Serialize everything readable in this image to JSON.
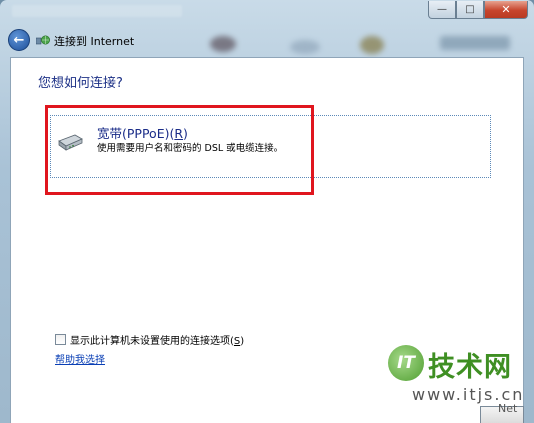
{
  "window": {
    "close_glyph": "✕",
    "minimize_glyph": "—",
    "maximize_glyph": "□"
  },
  "nav": {
    "back_glyph": "←",
    "title": "连接到 Internet"
  },
  "content": {
    "question": "您想如何连接?",
    "option": {
      "icon": "modem-icon",
      "title_prefix": "宽带(PPPoE)(",
      "title_accel": "R",
      "title_suffix": ")",
      "description": "使用需要用户名和密码的 DSL 或电缆连接。"
    },
    "checkbox": {
      "checked": false,
      "label_prefix": "显示此计算机未设置使用的连接选项(",
      "label_accel": "S",
      "label_suffix": ")"
    },
    "help_link": "帮助我选择"
  },
  "watermark": {
    "logo": "IT",
    "text": "技术网",
    "url": "www.itjs.cn",
    "suffix": "Net"
  },
  "colors": {
    "accent_red": "#e0161e",
    "link_blue": "#0a3fb5",
    "heading_blue": "#1e3287",
    "watermark_green": "#3f8f23"
  }
}
